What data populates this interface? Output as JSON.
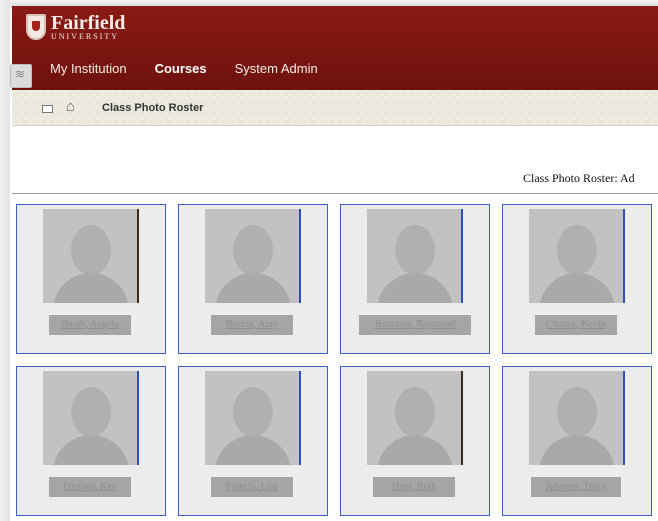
{
  "header": {
    "logo_name": "Fairfield",
    "logo_sub": "UNIVERSITY",
    "tabs": [
      {
        "label": "My Institution"
      },
      {
        "label": "Courses"
      },
      {
        "label": "System Admin"
      }
    ]
  },
  "breadcrumb": {
    "label": "Class Photo Roster"
  },
  "roster": {
    "title": "Class Photo Roster: Ad",
    "students": [
      {
        "name": "Booth, Angela"
      },
      {
        "name": "Boccia, Amy"
      },
      {
        "name": "Bourassa, Raymond"
      },
      {
        "name": "Chance, Kevin"
      },
      {
        "name": "Fontana, Ken"
      },
      {
        "name": "Francis, Lisa"
      },
      {
        "name": "Hunt, Ruth"
      },
      {
        "name": "Johnson, Tracy"
      }
    ]
  }
}
